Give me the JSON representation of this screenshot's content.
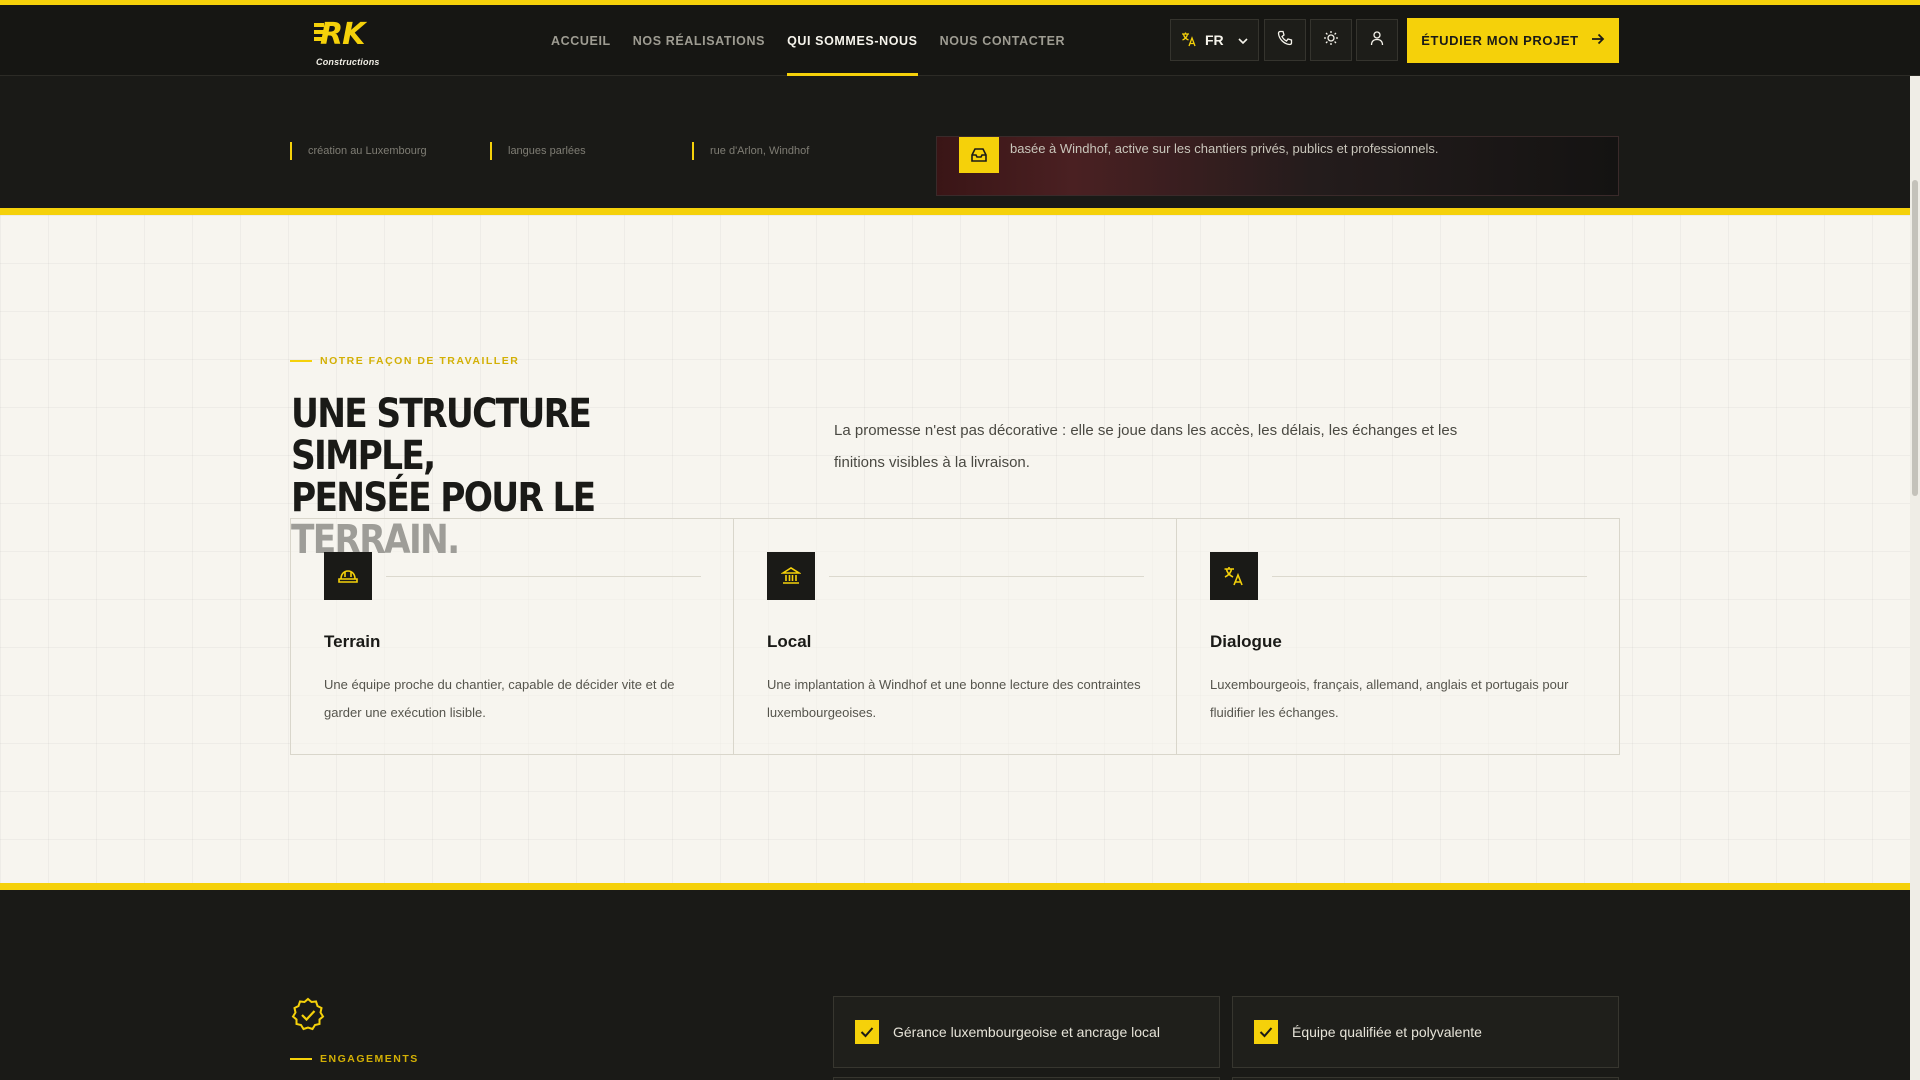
{
  "header": {
    "logo_text": "RK",
    "logo_sub": "Constructions",
    "nav": [
      {
        "label": "Accueil",
        "active": false
      },
      {
        "label": "Nos réalisations",
        "active": false
      },
      {
        "label": "Qui sommes-nous",
        "active": true
      },
      {
        "label": "Nous contacter",
        "active": false
      }
    ],
    "lang": "FR",
    "cta_label": "Étudier mon projet"
  },
  "hero_remnant": {
    "stats": [
      "création au Luxembourg",
      "langues parlées",
      "rue d'Arlon, Windhof"
    ],
    "card_text": "basée à Windhof, active sur les chantiers privés, publics et professionnels."
  },
  "approach": {
    "eyebrow": "Notre façon de travailler",
    "headline_line1": "Une structure simple,",
    "headline_line2": "pensée pour le terrain.",
    "intro": "La promesse n'est pas décorative : elle se joue dans les accès, les délais, les échanges et les finitions visibles à la livraison.",
    "cards": [
      {
        "title": "Terrain",
        "text": "Une équipe proche du chantier, capable de décider vite et de garder une exécution lisible.",
        "icon": "hard-hat-icon"
      },
      {
        "title": "Local",
        "text": "Une implantation à Windhof et une bonne lecture des contraintes luxembourgeoises.",
        "icon": "institution-icon"
      },
      {
        "title": "Dialogue",
        "text": "Luxembourgeois, français, allemand, anglais et portugais pour fluidifier les échanges.",
        "icon": "translate-icon"
      }
    ]
  },
  "engagements": {
    "eyebrow": "Engagements",
    "items": [
      "Gérance luxembourgeoise et ancrage local",
      "Équipe qualifiée et polyvalente"
    ]
  },
  "colors": {
    "accent": "#f5d10a",
    "dark": "#1a1a17",
    "light": "#f7f5ef"
  }
}
